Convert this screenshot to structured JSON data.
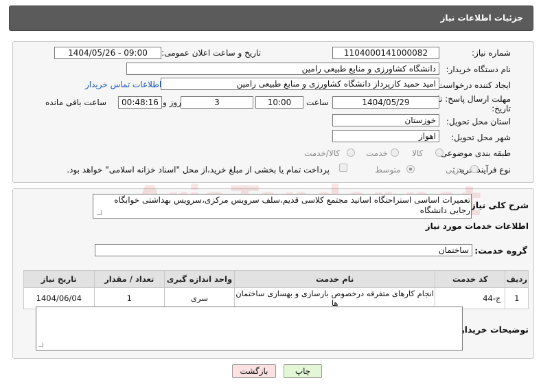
{
  "header": {
    "title": "جزئیات اطلاعات نیاز"
  },
  "form": {
    "need_number_label": "شماره نیاز:",
    "need_number": "1104000141000082",
    "announce_label": "تاریخ و ساعت اعلان عمومی:",
    "announce_value": "1404/05/26 - 09:00",
    "buyer_org_label": "نام دستگاه خریدار:",
    "buyer_org": "دانشگاه کشاورزی و منابع طبیعی رامین",
    "creator_label": "ایجاد کننده درخواست:",
    "creator": "امید حمید کارپرداز دانشگاه کشاورزی و منابع طبیعی رامین",
    "contact_link": "اطلاعات تماس خریدار",
    "deadline_label_1": "مهلت ارسال پاسخ: تا",
    "deadline_label_2": "تاریخ:",
    "deadline_date": "1404/05/29",
    "time_label": "ساعت",
    "deadline_time": "10:00",
    "days_value": "3",
    "days_label": "روز و",
    "remaining_time": "00:48:16",
    "remaining_label": "ساعت باقی مانده",
    "province_label": "استان محل تحویل:",
    "province": "خوزستان",
    "city_label": "شهر محل تحویل:",
    "city": "اهواز",
    "category_label": "طبقه بندی موضوعی:",
    "category_options": [
      "کالا",
      "خدمت",
      "کالا/خدمت"
    ],
    "category_selected": "خدمت",
    "process_label": "نوع فرآیند خرید :",
    "process_options": [
      "جزیی",
      "متوسط"
    ],
    "process_selected": "متوسط",
    "payment_note": "پرداخت تمام یا بخشی از مبلغ خرید،از محل \"اسناد خزانه اسلامی\" خواهد بود."
  },
  "description": {
    "label": "شرح کلی نیاز:",
    "text": "تعمیرات اساسی استراحتگاه اساتید مجتمع کلاسی قدیم،سلف سرویس مرکزی،سرویس بهداشتی خوابگاه رجایی دانشگاه"
  },
  "services": {
    "section_title": "اطلاعات خدمات مورد نیاز",
    "group_label": "گروه خدمت:",
    "group_value": "ساختمان",
    "columns": [
      "ردیف",
      "کد خدمت",
      "نام خدمت",
      "واحد اندازه گیری",
      "تعداد / مقدار",
      "تاریخ نیاز"
    ],
    "rows": [
      [
        "1",
        "ج-44",
        "انجام کارهای متفرقه درخصوص بازسازی و بهسازی ساختمان ها",
        "سری",
        "1",
        "1404/06/04"
      ]
    ]
  },
  "buyer_notes": {
    "label": "توضیحات خریدار:",
    "value": ""
  },
  "buttons": {
    "print": "چاپ",
    "back": "بازگشت"
  },
  "watermark": "AriaTender.net",
  "colors": {
    "header_bg": "#5b5b5b",
    "link": "#1a57b6",
    "print_bg": "#e3f7d6",
    "back_bg": "#fbe1e1"
  }
}
